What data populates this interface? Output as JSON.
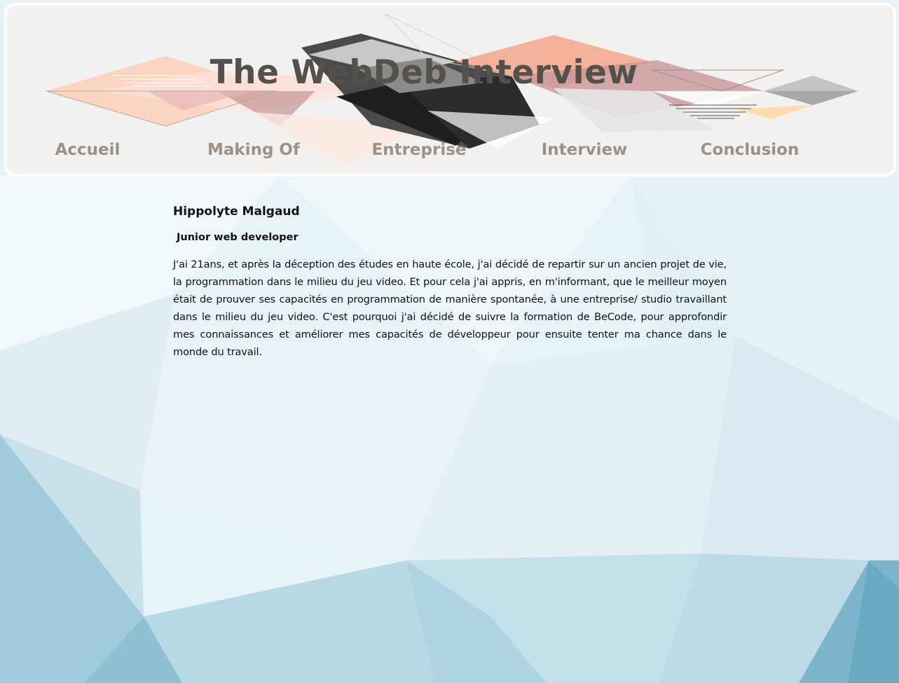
{
  "header": {
    "title": "The WebDeb Interview"
  },
  "nav": {
    "items": [
      {
        "label": "Accueil"
      },
      {
        "label": "Making Of"
      },
      {
        "label": "Entreprise"
      },
      {
        "label": "Interview"
      },
      {
        "label": "Conclusion"
      }
    ]
  },
  "profile": {
    "name": "Hippolyte Malgaud",
    "role": "Junior web developer",
    "bio": "J'ai 21ans, et après la déception des études en haute école, j'ai décidé de repartir sur un ancien projet de vie, la programmation dans le milieu du jeu video. Et pour cela j'ai appris, en m'informant, que le meilleur moyen était de prouver ses capacités en programmation de manière spontanée, à une entreprise/ studio travaillant dans le milieu du jeu video. C'est pourquoi j'ai décidé de suivre la formation de BeCode, pour approfondir mes connaissances et améliorer mes capacités de développeur pour ensuite tenter ma chance dans le monde du travail."
  },
  "colors": {
    "title": "#54514a",
    "nav": "#9c9182",
    "header_bg": "#f2f1f0",
    "page_bg_light": "#eaf5f9",
    "page_bg_dark": "#5fa6c0"
  }
}
